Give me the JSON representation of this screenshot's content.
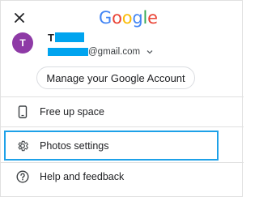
{
  "header": {
    "logo_letters": [
      {
        "char": "G",
        "color": "#4285F4"
      },
      {
        "char": "o",
        "color": "#EA4335"
      },
      {
        "char": "o",
        "color": "#FBBC05"
      },
      {
        "char": "g",
        "color": "#4285F4"
      },
      {
        "char": "l",
        "color": "#34A853"
      },
      {
        "char": "e",
        "color": "#EA4335"
      }
    ],
    "close_icon": "close-icon"
  },
  "account": {
    "avatar_letter": "T",
    "avatar_color": "#8e3aa6",
    "name_initial": "T",
    "email_domain": "@gmail.com",
    "redaction_color": "#00a4ef"
  },
  "manage_button_label": "Manage your Google Account",
  "menu": {
    "items": [
      {
        "label": "Free up space",
        "icon": "phone-icon"
      },
      {
        "label": "Photos settings",
        "icon": "gear-icon"
      },
      {
        "label": "Help and feedback",
        "icon": "help-icon"
      }
    ],
    "highlight_color": "#1da1e8"
  }
}
